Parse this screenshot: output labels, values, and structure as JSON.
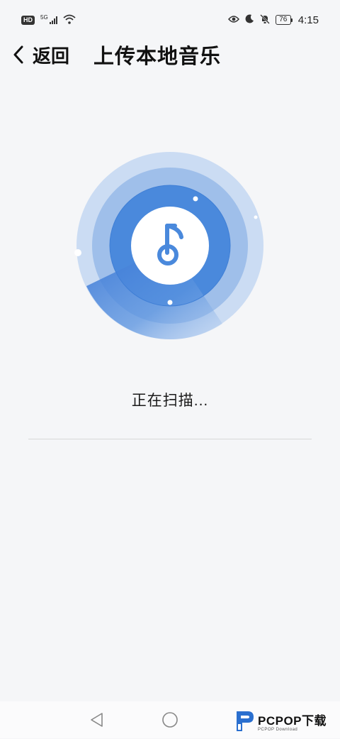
{
  "status_bar": {
    "hd_label": "HD",
    "network_label": "5G",
    "battery_level": "76",
    "time": "4:15"
  },
  "header": {
    "back_label": "返回",
    "title": "上传本地音乐"
  },
  "main": {
    "scan_status": "正在扫描..."
  },
  "watermark": {
    "brand": "PCPOP下载",
    "sub": "PCPOP Download"
  },
  "colors": {
    "accent": "#4a89dc",
    "background": "#f5f6f8"
  },
  "icons": {
    "back": "chevron-left-icon",
    "music": "music-note-icon"
  }
}
